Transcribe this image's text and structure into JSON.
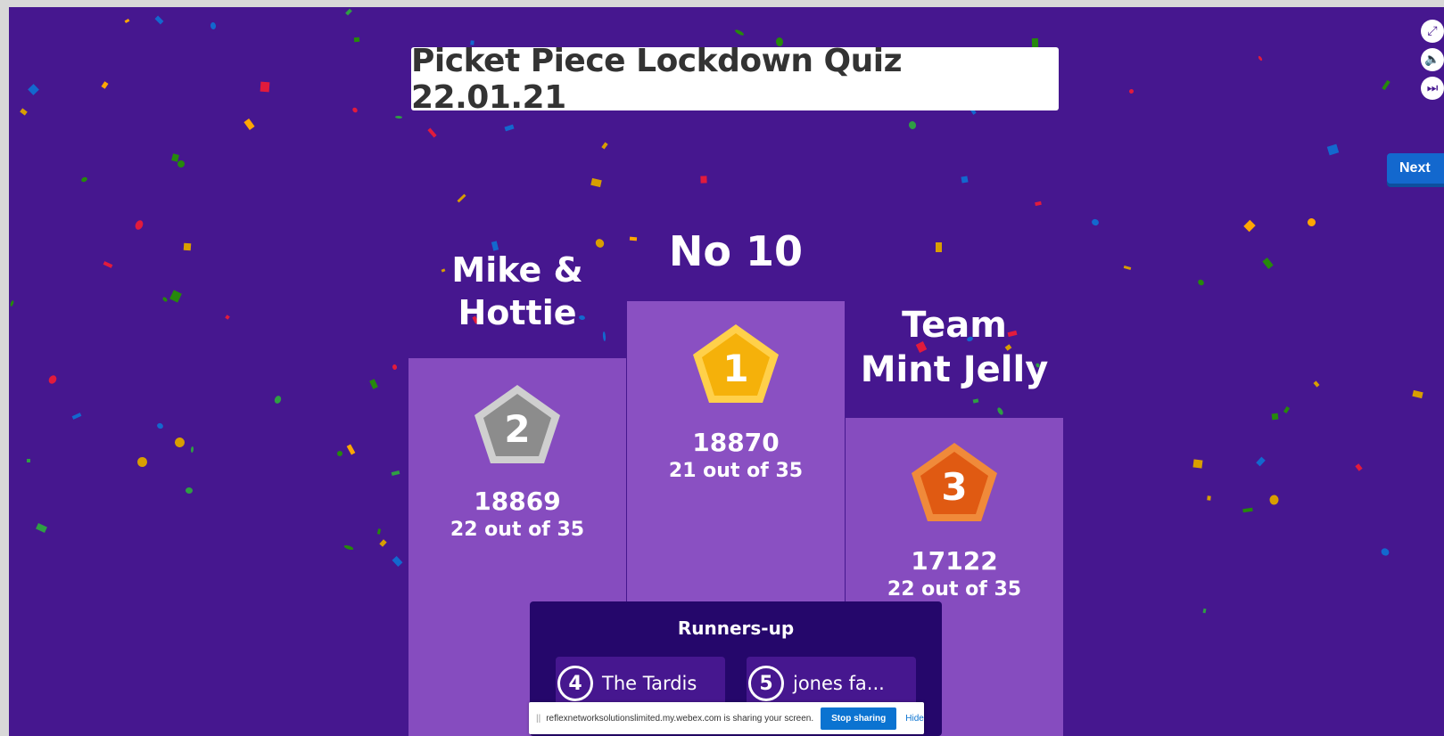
{
  "title": "Picket Piece Lockdown Quiz 22.01.21",
  "controls": {
    "fullscreen_icon": "fullscreen-icon",
    "sound_icon": "volume-icon",
    "skip_icon": "skip-icon"
  },
  "next_label": "Next",
  "podium": [
    {
      "rank": "2",
      "name": "Mike &\nHottie",
      "score": "18869",
      "correct": "22 out of 35",
      "medal_color": "#8c8c8c"
    },
    {
      "rank": "1",
      "name": "No 10",
      "score": "18870",
      "correct": "21 out of 35",
      "medal_color": "#f5b10a"
    },
    {
      "rank": "3",
      "name": "Team\nMint Jelly",
      "score": "17122",
      "correct": "22 out of 35",
      "medal_color": "#e05a12"
    }
  ],
  "runners_up": {
    "title": "Runners-up",
    "items": [
      {
        "rank": "4",
        "name": "The Tardis"
      },
      {
        "rank": "5",
        "name": "jones fa..."
      }
    ]
  },
  "share_bar": {
    "message": "reflexnetworksolutionslimited.my.webex.com is sharing your screen.",
    "stop_label": "Stop sharing",
    "hide_label": "Hide"
  },
  "colors": {
    "background": "#46178f",
    "podium": "#864cbf",
    "next": "#1368ce"
  }
}
